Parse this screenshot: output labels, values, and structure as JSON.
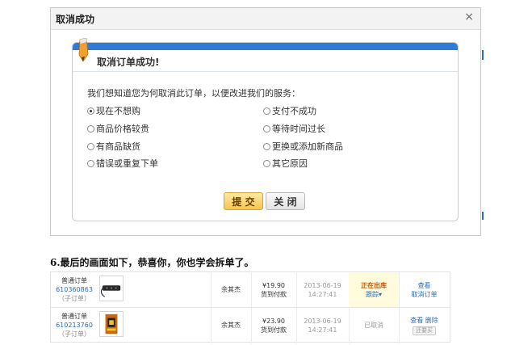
{
  "dialog": {
    "title": "取消成功",
    "close_glyph": "×"
  },
  "panel": {
    "title": "取消订单成功!",
    "question": "我们想知道您为何取消此订单，以便改进我们的服务：",
    "options": [
      {
        "label": "现在不想购",
        "selected": true
      },
      {
        "label": "支付不成功",
        "selected": false
      },
      {
        "label": "商品价格较贵",
        "selected": false
      },
      {
        "label": "等待时间过长",
        "selected": false
      },
      {
        "label": "有商品缺货",
        "selected": false
      },
      {
        "label": "更换或添加新商品",
        "selected": false
      },
      {
        "label": "错误或重复下单",
        "selected": false
      },
      {
        "label": "其它原因",
        "selected": false
      }
    ],
    "submit_label": "提 交",
    "close_label": "关 闭"
  },
  "caption": "6.最后的画面如下，恭喜你，你也学会拆单了。",
  "orders": [
    {
      "type": "普通订单",
      "id": "610360863",
      "sub": "（子订单）",
      "buyer": "余其杰",
      "amount": "¥19.90",
      "payment": "货到付款",
      "date": "2013-06-19",
      "time": "14:27:41",
      "status": "正在出库",
      "track": "跟踪▾",
      "action1": "查看",
      "action2": "取消订单"
    },
    {
      "type": "普通订单",
      "id": "610213760",
      "sub": "（子订单）",
      "buyer": "余其杰",
      "amount": "¥23.90",
      "payment": "货到付款",
      "date": "2013-06-19",
      "time": "14:27:41",
      "status": "已取消",
      "action1": "查看",
      "action2": "删除",
      "action3": "还要买"
    }
  ],
  "colors": {
    "accent_blue": "#2f7bd6",
    "submit_yellow": "#f6c64e",
    "status_orange": "#c35400"
  }
}
